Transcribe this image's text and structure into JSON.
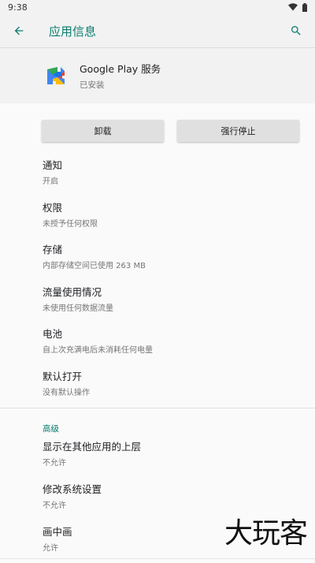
{
  "status_bar": {
    "time": "9:38"
  },
  "app_bar": {
    "title": "应用信息"
  },
  "app": {
    "name": "Google Play 服务",
    "status": "已安装"
  },
  "buttons": {
    "uninstall": "卸载",
    "force_stop": "强行停止"
  },
  "items": [
    {
      "title": "通知",
      "subtitle": "开启"
    },
    {
      "title": "权限",
      "subtitle": "未授予任何权限"
    },
    {
      "title": "存储",
      "subtitle": "内部存储空间已使用 263 MB"
    },
    {
      "title": "流量使用情况",
      "subtitle": "未使用任何数据流量"
    },
    {
      "title": "电池",
      "subtitle": "自上次充满电后未消耗任何电量"
    },
    {
      "title": "默认打开",
      "subtitle": "没有默认操作"
    }
  ],
  "advanced": {
    "label": "高级",
    "items": [
      {
        "title": "显示在其他应用的上层",
        "subtitle": "不允许"
      },
      {
        "title": "修改系统设置",
        "subtitle": "不允许"
      },
      {
        "title": "画中画",
        "subtitle": "允许"
      }
    ]
  },
  "watermark": "大玩客",
  "colors": {
    "accent": "#0b7d70",
    "header_bg": "#f2f2f2",
    "page_bg": "#fafafa"
  }
}
